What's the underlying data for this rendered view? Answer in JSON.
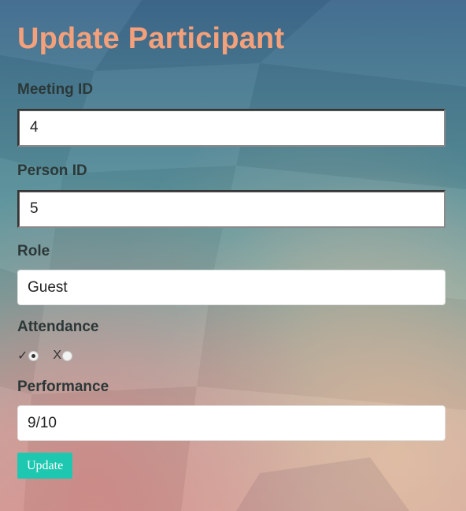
{
  "page": {
    "title": "Update Participant"
  },
  "form": {
    "meeting_id": {
      "label": "Meeting ID",
      "value": "4"
    },
    "person_id": {
      "label": "Person ID",
      "value": "5"
    },
    "role": {
      "label": "Role",
      "value": "Guest"
    },
    "attendance": {
      "label": "Attendance",
      "options": [
        {
          "label": "✓",
          "checked": true
        },
        {
          "label": "X",
          "checked": false
        }
      ]
    },
    "performance": {
      "label": "Performance",
      "value": "9/10"
    },
    "submit_label": "Update"
  },
  "colors": {
    "title": "#f4a07a",
    "button": "#1ec8b0"
  }
}
